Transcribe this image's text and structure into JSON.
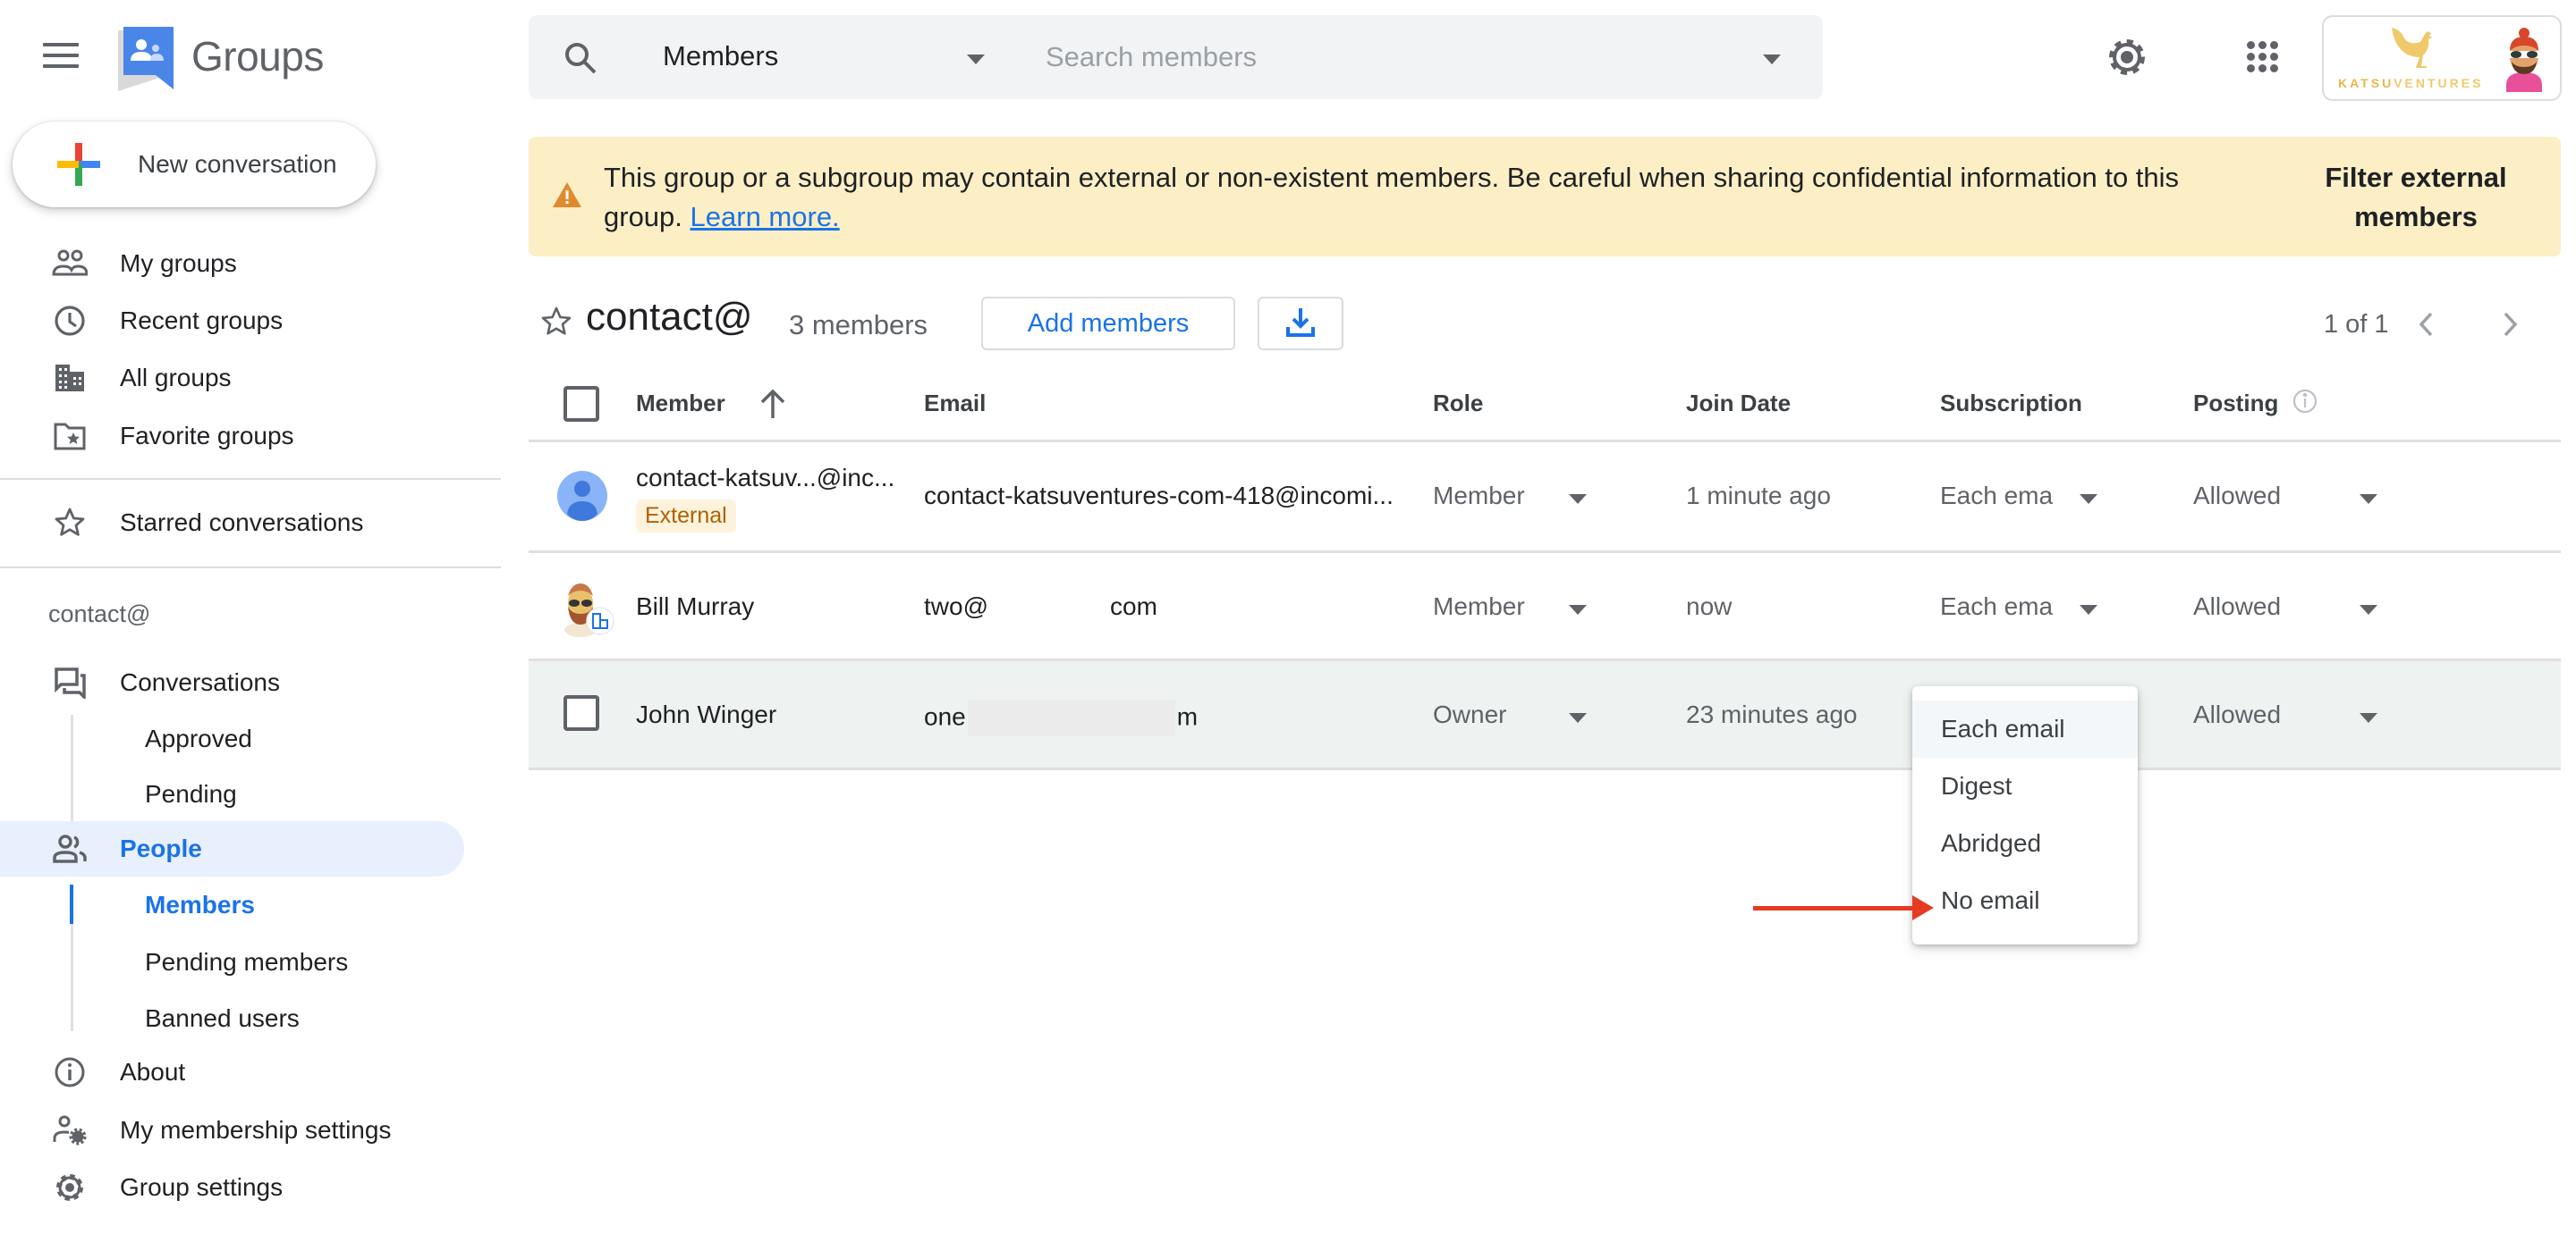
{
  "app": {
    "name": "Groups",
    "menu_icon": "hamburger-menu-icon",
    "logo_icon": "groups-logo-icon"
  },
  "sidebar": {
    "new_conversation_label": "New conversation",
    "primary_items": [
      {
        "label": "My groups",
        "icon": "my-groups-icon"
      },
      {
        "label": "Recent groups",
        "icon": "clock-icon"
      },
      {
        "label": "All groups",
        "icon": "building-icon"
      },
      {
        "label": "Favorite groups",
        "icon": "folder-star-icon"
      }
    ],
    "starred_label": "Starred conversations",
    "group_label": "contact@",
    "group_items": {
      "conversations": "Conversations",
      "approved": "Approved",
      "pending": "Pending",
      "people": "People",
      "members": "Members",
      "pending_members": "Pending members",
      "banned_users": "Banned users",
      "about": "About",
      "membership_settings": "My membership settings",
      "group_settings": "Group settings"
    },
    "active_item": "People",
    "active_sub_item": "Members"
  },
  "search": {
    "scope": "Members",
    "placeholder": "Search members",
    "value": ""
  },
  "account": {
    "brand_prefix": "KATSU",
    "brand_suffix": "VENTURES"
  },
  "banner": {
    "message": "This group or a subgroup may contain external or non-existent members. Be careful when sharing confidential information to this group.",
    "link_label": "Learn more.",
    "action_label": "Filter external members",
    "warning_icon": "warning-icon"
  },
  "group": {
    "title": "contact@",
    "member_count": "3 members",
    "add_members_label": "Add members",
    "download_icon": "download-icon"
  },
  "pagination": {
    "text": "1 of 1"
  },
  "table": {
    "columns": {
      "member": "Member",
      "email": "Email",
      "role": "Role",
      "join_date": "Join Date",
      "subscription": "Subscription",
      "posting": "Posting"
    },
    "sort": {
      "column": "Member",
      "direction": "ascending"
    },
    "rows": [
      {
        "name": "contact-katsuv...@inc...",
        "badge": "External",
        "email": "contact-katsuventures-com-418@incomi...",
        "role": "Member",
        "join_date": "1 minute ago",
        "subscription": "Each ema",
        "posting": "Allowed",
        "avatar": "default-avatar"
      },
      {
        "name": "Bill Murray",
        "badge": "",
        "email_start": "two@",
        "email_end": "com",
        "role": "Member",
        "join_date": "now",
        "subscription": "Each ema",
        "posting": "Allowed",
        "avatar": "photo-avatar"
      },
      {
        "name": "John Winger",
        "badge": "",
        "email_start": "one",
        "email_end": "m",
        "role": "Owner",
        "join_date": "23 minutes ago",
        "subscription": "Each email",
        "posting": "Allowed",
        "avatar": "checkbox"
      }
    ]
  },
  "subscription_menu": {
    "options": [
      "Each email",
      "Digest",
      "Abridged",
      "No email"
    ],
    "selected": "Each email",
    "highlighted_by_arrow": "No email"
  },
  "colors": {
    "accent": "#1a73e8",
    "banner_bg": "#fcefc6",
    "warning": "#e37400",
    "annotation_arrow": "#e53b23",
    "active_nav_bg": "#e8f0fe"
  }
}
